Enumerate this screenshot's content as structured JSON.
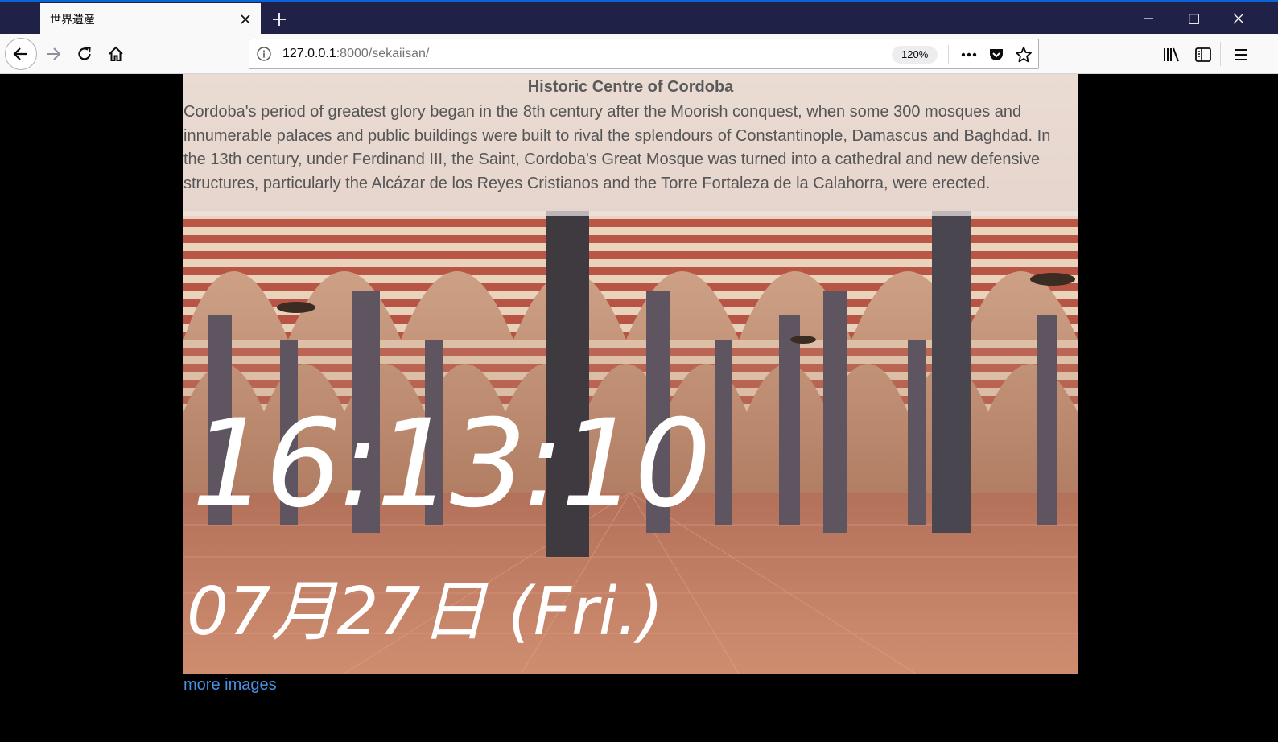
{
  "browser": {
    "tab_title": "世界遺産",
    "url_host": "127.0.0.1",
    "url_rest": ":8000/sekaiisan/",
    "zoom": "120%",
    "icons": [
      "back-icon",
      "forward-icon",
      "reload-icon",
      "home-icon",
      "info-icon",
      "more-icon",
      "pocket-icon",
      "star-icon",
      "library-icon",
      "sidebar-icon",
      "menu-icon",
      "close-icon",
      "plus-icon",
      "minimize-icon",
      "maximize-icon"
    ]
  },
  "site": {
    "title": "Historic Centre of Cordoba",
    "description": "Cordoba's period of greatest glory began in the 8th century after the Moorish conquest, when some 300 mosques and innumerable palaces and public buildings were built to rival the splendours of Constantinople, Damascus and Baghdad. In the 13th century, under Ferdinand III, the Saint, Cordoba's Great Mosque was turned into a cathedral and new defensive structures, particularly the Alcázar de los Reyes Cristianos and the Torre Fortaleza de la Calahorra, were erected.",
    "time": "16:13:10",
    "date": "07月27日 (Fri.)",
    "more_link": "more images"
  },
  "colors": {
    "titlebar": "#1f2147",
    "link": "#4a90e2",
    "background": "#000000"
  }
}
